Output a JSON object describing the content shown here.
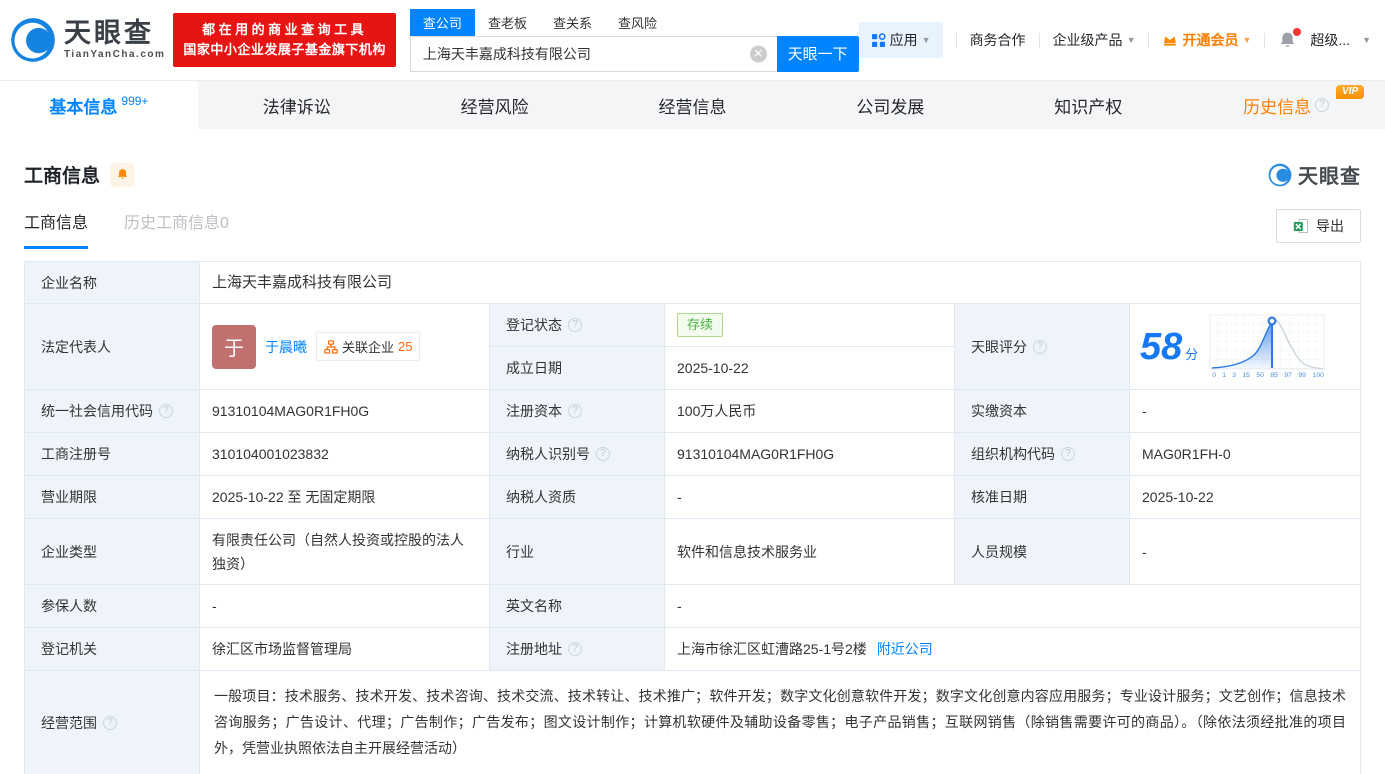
{
  "header": {
    "logo_brand": "天眼查",
    "logo_domain": "TianYanCha.com",
    "banner_line1": "都在用的商业查询工具",
    "banner_line2": "国家中小企业发展子基金旗下机构",
    "tab_company": "查公司",
    "tab_boss": "查老板",
    "tab_relation": "查关系",
    "tab_risk": "查风险",
    "search_value": "上海天丰嘉成科技有限公司",
    "search_button": "天眼一下",
    "nav_apps": "应用",
    "nav_biz": "商务合作",
    "nav_enterprise": "企业级产品",
    "nav_vip": "开通会员",
    "nav_super": "超级..."
  },
  "tabs": {
    "basic": "基本信息",
    "basic_badge": "999+",
    "legal": "法律诉讼",
    "risk": "经营风险",
    "operation": "经营信息",
    "development": "公司发展",
    "ip": "知识产权",
    "history": "历史信息",
    "history_vip": "VIP"
  },
  "section": {
    "title": "工商信息",
    "watermark_brand": "天眼查",
    "subtab_current": "工商信息",
    "subtab_history": "历史工商信息0",
    "export_label": "导出"
  },
  "info": {
    "company_name_label": "企业名称",
    "company_name": "上海天丰嘉成科技有限公司",
    "legal_rep_label": "法定代表人",
    "legal_rep_avatar": "于",
    "legal_rep_name": "于晨曦",
    "related_label": "关联企业",
    "related_count": "25",
    "reg_status_label": "登记状态",
    "reg_status": "存续",
    "establish_label": "成立日期",
    "establish_date": "2025-10-22",
    "score_label": "天眼评分",
    "score_value": "58",
    "score_unit": "分",
    "credit_code_label": "统一社会信用代码",
    "credit_code": "91310104MAG0R1FH0G",
    "reg_capital_label": "注册资本",
    "reg_capital": "100万人民币",
    "paid_capital_label": "实缴资本",
    "paid_capital": "-",
    "reg_number_label": "工商注册号",
    "reg_number": "310104001023832",
    "taxpayer_id_label": "纳税人识别号",
    "taxpayer_id": "91310104MAG0R1FH0G",
    "org_code_label": "组织机构代码",
    "org_code": "MAG0R1FH-0",
    "business_term_label": "营业期限",
    "business_term": "2025-10-22 至 无固定期限",
    "taxpayer_quality_label": "纳税人资质",
    "taxpayer_quality": "-",
    "approval_date_label": "核准日期",
    "approval_date": "2025-10-22",
    "company_type_label": "企业类型",
    "company_type": "有限责任公司（自然人投资或控股的法人独资）",
    "industry_label": "行业",
    "industry": "软件和信息技术服务业",
    "staff_size_label": "人员规模",
    "staff_size": "-",
    "insured_label": "参保人数",
    "insured": "-",
    "english_name_label": "英文名称",
    "english_name": "-",
    "reg_authority_label": "登记机关",
    "reg_authority": "徐汇区市场监督管理局",
    "reg_address_label": "注册地址",
    "reg_address": "上海市徐汇区虹漕路25-1号2楼",
    "nearby_link": "附近公司",
    "business_scope_label": "经营范围",
    "business_scope": "一般项目：技术服务、技术开发、技术咨询、技术交流、技术转让、技术推广；软件开发；数字文化创意软件开发；数字文化创意内容应用服务；专业设计服务；文艺创作；信息技术咨询服务；广告设计、代理；广告制作；广告发布；图文设计制作；计算机软硬件及辅助设备零售；电子产品销售；互联网销售（除销售需要许可的商品）。（除依法须经批准的项目外，凭营业执照依法自主开展经营活动）"
  },
  "score_chart": {
    "type": "area",
    "ticks": [
      "0",
      "1",
      "3",
      "15",
      "50",
      "85",
      "97",
      "99",
      "100"
    ],
    "marker_value": 58
  },
  "colors": {
    "primary_blue": "#0084ff",
    "banner_red": "#e71414",
    "vip_orange": "#ff7d00",
    "history_orange": "#ff8000",
    "status_green": "#49b33b",
    "label_bg": "#eef4fa",
    "border": "#e0e9f1",
    "avatar_bg": "#c0706e",
    "score_blue": "#1678f2"
  }
}
